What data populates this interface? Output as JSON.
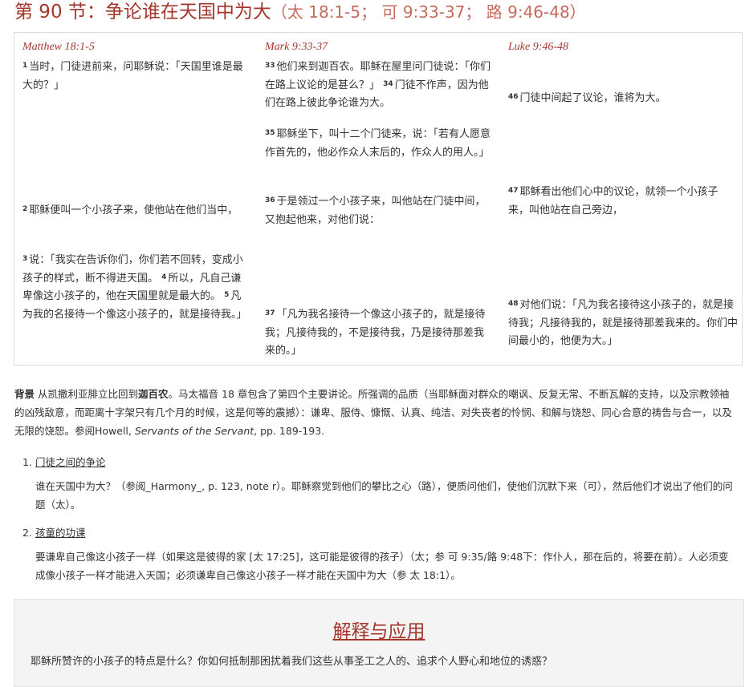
{
  "section": {
    "title": "第 90 节：争论谁在天国中为大",
    "ref": "（太 18:1-5； 可 9:33-37； 路 9:46-48）"
  },
  "harmony": {
    "matthew": {
      "header": "Matthew 18:1-5",
      "v1": {
        "n": "1",
        "t": "当时，门徒进前来，问耶稣说：「天国里谁是最大的？」"
      },
      "v2": {
        "n": "2",
        "t": "耶稣便叫一个小孩子来，使他站在他们当中，"
      },
      "v3": {
        "n": "3",
        "t": "说：「我实在告诉你们，你们若不回转，变成小孩子的样式，断不得进天国。"
      },
      "v4": {
        "n": "4",
        "t": "所以，凡自己谦卑像这小孩子的，他在天国里就是最大的。"
      },
      "v5": {
        "n": "5",
        "t": "凡为我的名接待一个像这小孩子的，就是接待我。」"
      }
    },
    "mark": {
      "header": "Mark 9:33-37",
      "v33": {
        "n": "33",
        "t": "他们来到迦百农。耶稣在屋里问门徒说：「你们在路上议论的是甚么？」"
      },
      "v34": {
        "n": "34",
        "t": "门徒不作声，因为他们在路上彼此争论谁为大。"
      },
      "v35": {
        "n": "35",
        "t": "耶稣坐下，叫十二个门徒来，说：「若有人愿意作首先的，他必作众人末后的，作众人的用人。」"
      },
      "v36": {
        "n": "36",
        "t": "于是领过一个小孩子来，叫他站在门徒中间，又抱起他来，对他们说："
      },
      "v37": {
        "n": "37",
        "t": "「凡为我名接待一个像这小孩子的，就是接待我；凡接待我的，不是接待我，乃是接待那差我来的。」"
      }
    },
    "luke": {
      "header": "Luke 9:46-48",
      "v46": {
        "n": "46",
        "t": "门徒中间起了议论，谁将为大。"
      },
      "v47": {
        "n": "47",
        "t": "耶稣看出他们心中的议论，就领一个小孩子来，叫他站在自己旁边，"
      },
      "v48": {
        "n": "48",
        "t": "对他们说：「凡为我名接待这小孩子的，就是接待我；凡接待我的，就是接待那差我来的。你们中间最小的，他便为大。」"
      }
    }
  },
  "background": {
    "label": "背景",
    "t1": "从凯撒利亚腓立比回到",
    "place": "迦百农",
    "t2": "。马太福音 18 章包含了第四个主要讲论。所强调的品质（当耶稣面对群众的嘲讽、反复无常、不断瓦解的支持，以及宗教领袖的凶残敌意，而距离十字架只有几个月的时候，这是何等的震撼）：谦卑、服侍、慷慨、认真、纯洁、对失丧者的怜悯、和解与饶恕、同心合意的祷告与合一，以及无限的饶恕。参阅Howell, ",
    "book": "Servants of the Servant",
    "t3": ", pp. 189-193."
  },
  "points": [
    {
      "num": "1.",
      "head": "门徒之间的争论",
      "body": "谁在天国中为大？（参阅_Harmony_, p. 123, note r）。耶稣察觉到他们的攀比之心（路），便质问他们，使他们沉默下来（可），然后他们才说出了他们的问题（太）。"
    },
    {
      "num": "2.",
      "head": "孩童的功课",
      "body": "要谦卑自己像这小孩子一样（如果这是彼得的家 [太 17:25]，这可能是彼得的孩子）（太；参 可 9:35/路 9:48下：作仆人，那在后的，将要在前）。人必须变成像小孩子一样才能进入天国；必须谦卑自己像这小孩子一样才能在天国中为大（参 太 18:1）。"
    }
  ],
  "application": {
    "title": "解释与应用",
    "question": "耶稣所赞许的小孩子的特点是什么？你如何抵制那困扰着我们这些从事圣工之人的、追求个人野心和地位的诱惑？"
  }
}
